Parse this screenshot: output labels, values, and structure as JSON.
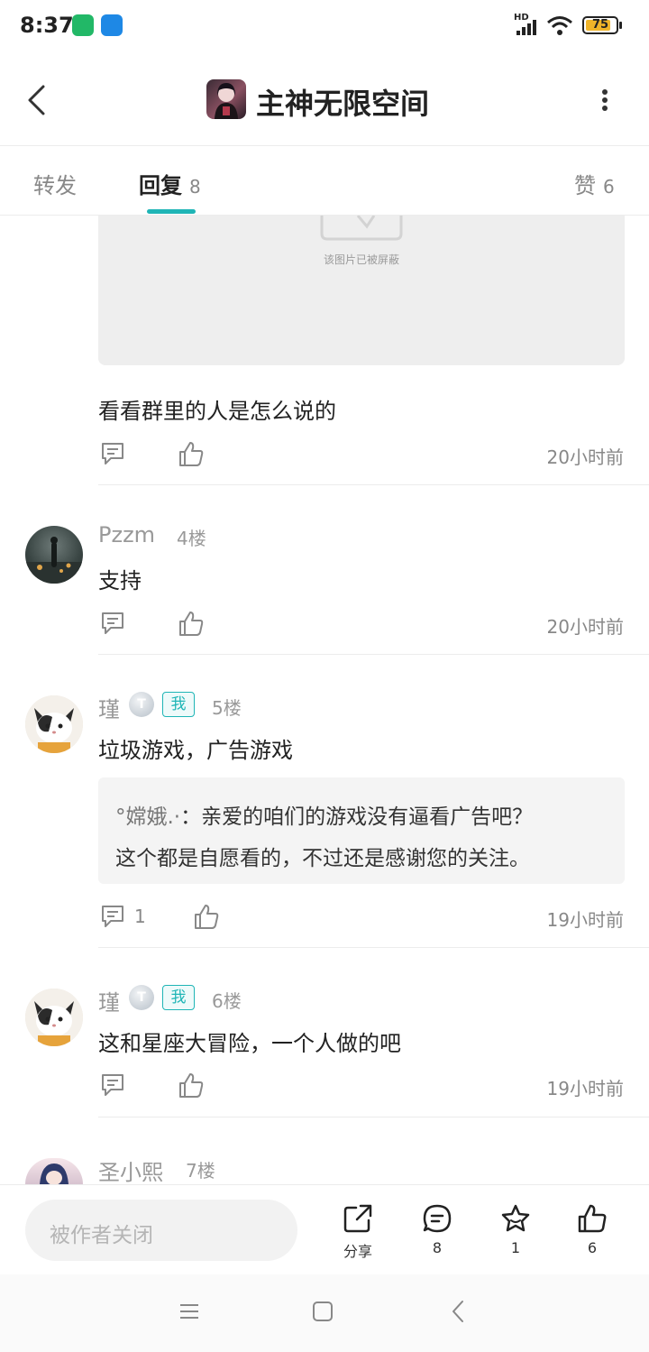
{
  "status": {
    "time": "8:37",
    "battery": "75",
    "network": "HD"
  },
  "header": {
    "title": "主神无限空间"
  },
  "tabs": [
    {
      "label": "转发",
      "count": ""
    },
    {
      "label": "回复",
      "count": "8"
    },
    {
      "label": "赞",
      "count": "6"
    }
  ],
  "prev_post": {
    "image_blocked_text": "该图片已被屏蔽",
    "text": "看看群里的人是怎么说的",
    "time": "20小时前"
  },
  "comments": [
    {
      "user": "Pzzm",
      "floor": "4楼",
      "text": "支持",
      "time": "20小时前",
      "reply_count": ""
    },
    {
      "user": "瑾",
      "me_badge": "我",
      "level_badge": "T",
      "floor": "5楼",
      "text": "垃圾游戏，广告游戏",
      "quote": {
        "name": "°嫦娥.·",
        "line1": "：亲爱的咱们的游戏没有逼看广告吧？",
        "line2": "这个都是自愿看的，不过还是感谢您的关注。"
      },
      "time": "19小时前",
      "reply_count": "1"
    },
    {
      "user": "瑾",
      "me_badge": "我",
      "level_badge": "T",
      "floor": "6楼",
      "text": "这和星座大冒险，一个人做的吧",
      "time": "19小时前",
      "reply_count": ""
    },
    {
      "user": "圣小熙",
      "floor": "7楼"
    }
  ],
  "bottom": {
    "input_placeholder": "被作者关闭",
    "share_label": "分享",
    "comment_count": "8",
    "star_count": "1",
    "like_count": "6"
  },
  "colors": {
    "accent": "#1fb5b6"
  }
}
